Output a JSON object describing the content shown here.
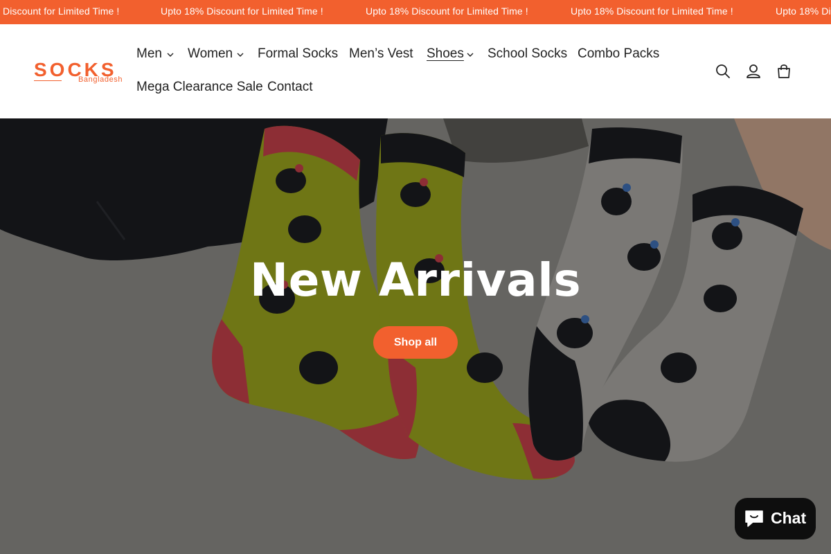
{
  "announcement": {
    "items": [
      "Discount for Limited Time !",
      "Upto 18% Discount for Limited Time !",
      "Upto 18% Discount for Limited Time !",
      "Upto 18% Discount for Limited Time !",
      "Upto 18% Di"
    ],
    "background_color": "#f2602e"
  },
  "header": {
    "logo": {
      "word": "SOCKS",
      "sub": "Bangladesh"
    },
    "nav": [
      {
        "label": "Men",
        "has_dropdown": true
      },
      {
        "label": "Women",
        "has_dropdown": true
      },
      {
        "label": "Formal Socks",
        "has_dropdown": false
      },
      {
        "label": "Men’s Vest",
        "has_dropdown": false
      },
      {
        "label": "Shoes",
        "has_dropdown": true,
        "active": true
      },
      {
        "label": "School Socks",
        "has_dropdown": false
      },
      {
        "label": "Combo Packs",
        "has_dropdown": false
      },
      {
        "label": "Mega Clearance Sale",
        "has_dropdown": false
      },
      {
        "label": "Contact",
        "has_dropdown": false
      }
    ],
    "icons": [
      "search-icon",
      "account-icon",
      "cart-icon"
    ]
  },
  "hero": {
    "title": "New Arrivals",
    "button_label": "Shop all"
  },
  "chat": {
    "label": "Chat",
    "icon": "chat-bubble-icon"
  },
  "colors": {
    "accent": "#f2602e",
    "chat_bg": "#0e0e0e"
  }
}
